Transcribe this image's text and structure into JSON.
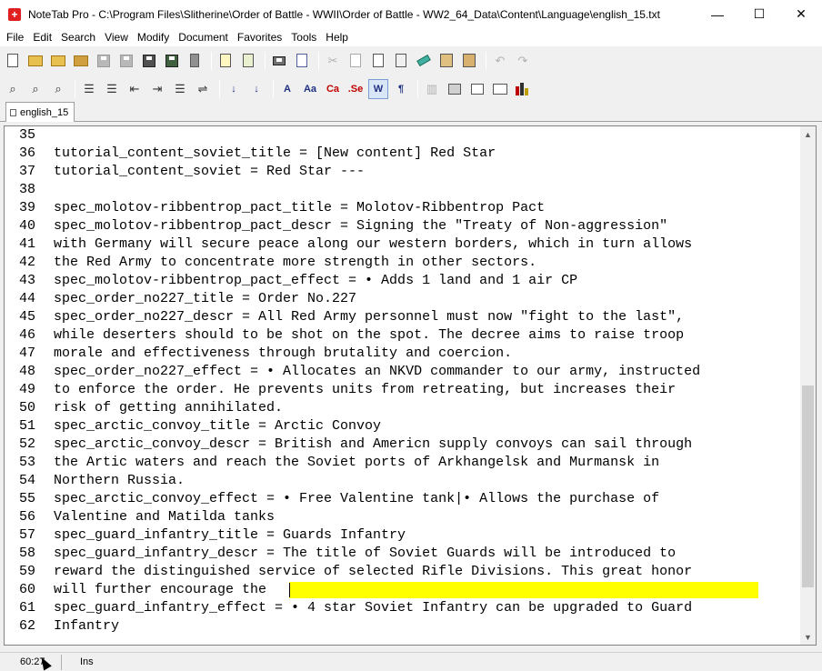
{
  "window": {
    "title": "NoteTab Pro  -  C:\\Program Files\\Slitherine\\Order of Battle - WWII\\Order of Battle - WW2_64_Data\\Content\\Language\\english_15.txt",
    "app_icon": "swiss-cross-icon",
    "minimize": "—",
    "maximize": "☐",
    "close": "✕"
  },
  "menu": [
    {
      "label": "File"
    },
    {
      "label": "Edit"
    },
    {
      "label": "Search"
    },
    {
      "label": "View"
    },
    {
      "label": "Modify"
    },
    {
      "label": "Document"
    },
    {
      "label": "Favorites"
    },
    {
      "label": "Tools"
    },
    {
      "label": "Help"
    }
  ],
  "toolbar2_text_icons": {
    "case_a": "A",
    "case_aa": "Aa",
    "ca": "Ca",
    "se": ".Se",
    "w": "W",
    "pilcrow": "¶",
    "sort_asc": "↓",
    "sort_desc": "↓"
  },
  "tab": {
    "label": "english_15"
  },
  "editor": {
    "lines": [
      {
        "n": "35",
        "text": ""
      },
      {
        "n": "36",
        "text": "tutorial_content_soviet_title = [New content] Red Star"
      },
      {
        "n": "37",
        "text": "tutorial_content_soviet = Red Star ---"
      },
      {
        "n": "38",
        "text": ""
      },
      {
        "n": "39",
        "text": "spec_molotov-ribbentrop_pact_title = Molotov-Ribbentrop Pact"
      },
      {
        "n": "40",
        "text": "spec_molotov-ribbentrop_pact_descr = Signing the \"Treaty of Non-aggression\""
      },
      {
        "n": "41",
        "text": "with Germany will secure peace along our western borders, which in turn allows"
      },
      {
        "n": "42",
        "text": "the Red Army to concentrate more strength in other sectors."
      },
      {
        "n": "43",
        "text": "spec_molotov-ribbentrop_pact_effect = • Adds 1 land and 1 air CP"
      },
      {
        "n": "44",
        "text": "spec_order_no227_title = Order No.227"
      },
      {
        "n": "45",
        "text": "spec_order_no227_descr = All Red Army personnel must now \"fight to the last\","
      },
      {
        "n": "46",
        "text": "while deserters should to be shot on the spot. The decree aims to raise troop"
      },
      {
        "n": "47",
        "text": "morale and effectiveness through brutality and coercion."
      },
      {
        "n": "48",
        "text": "spec_order_no227_effect = • Allocates an NKVD commander to our army, instructed"
      },
      {
        "n": "49",
        "text": "to enforce the order. He prevents units from retreating, but increases their"
      },
      {
        "n": "50",
        "text": "risk of getting annihilated."
      },
      {
        "n": "51",
        "text": "spec_arctic_convoy_title = Arctic Convoy"
      },
      {
        "n": "52",
        "text": "spec_arctic_convoy_descr = British and Americn supply convoys can sail through"
      },
      {
        "n": "53",
        "text": "the Artic waters and reach the Soviet ports of Arkhangelsk and Murmansk in"
      },
      {
        "n": "54",
        "text": "Northern Russia."
      },
      {
        "n": "55",
        "text": "spec_arctic_convoy_effect = • Free Valentine tank|• Allows the purchase of"
      },
      {
        "n": "56",
        "text": "Valentine and Matilda tanks"
      },
      {
        "n": "57",
        "text": "spec_guard_infantry_title = Guards Infantry"
      },
      {
        "n": "58",
        "text": "spec_guard_infantry_descr = The title of Soviet Guards will be introduced to"
      },
      {
        "n": "59",
        "text": "reward the distinguished service of selected Rifle Divisions. This great honor"
      },
      {
        "n": "60",
        "text": "will further encourage the",
        "highlight_color": "#ffff00"
      },
      {
        "n": "61",
        "text": "spec_guard_infantry_effect = • 4 star Soviet Infantry can be upgraded to Guard"
      },
      {
        "n": "62",
        "text": "Infantry"
      }
    ]
  },
  "scrollbar": {
    "up": "▲",
    "down": "▼"
  },
  "status": {
    "position": "60:27",
    "mode": "Ins"
  }
}
